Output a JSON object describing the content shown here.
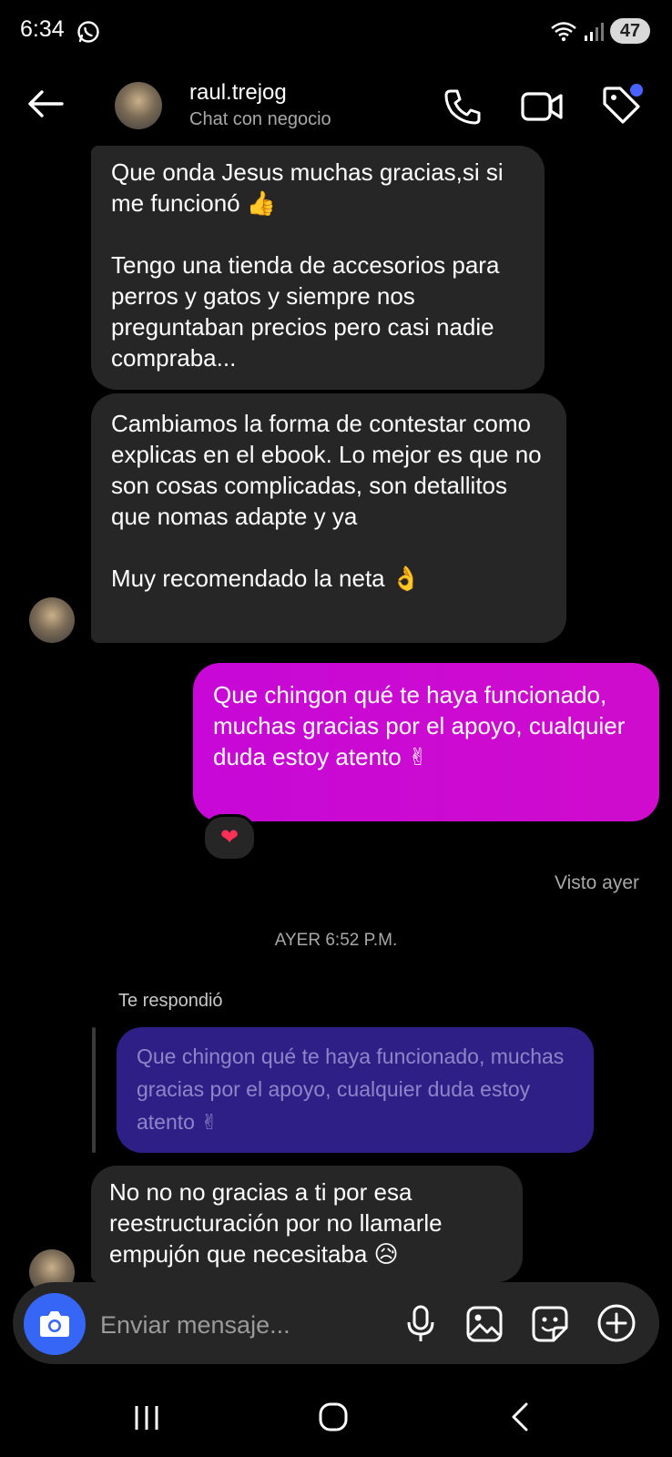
{
  "status_bar": {
    "time": "6:34",
    "battery": "47"
  },
  "header": {
    "contact_name": "raul.trejog",
    "subtitle": "Chat con negocio"
  },
  "messages": {
    "incoming_1": "Que onda Jesus muchas gracias,si si me funcionó 👍\n\nTengo una tienda de accesorios para perros y gatos y siempre nos preguntaban precios pero casi nadie compraba...",
    "incoming_2": "Cambiamos la forma de contestar como explicas en el ebook. Lo mejor es que no son cosas complicadas, son detallitos que nomas adapte y ya\n\nMuy recomendado la neta 👌",
    "outgoing_1": "Que chingon qué te haya funcionado, muchas gracias por el apoyo, cualquier duda estoy atento ✌",
    "reaction": "❤",
    "seen_text": "Visto ayer",
    "date_separator": "AYER 6:52 P.M.",
    "reply_label": "Te respondió",
    "quoted_text": "Que chingon qué te haya funcionado, muchas gracias por el apoyo, cualquier duda estoy atento ✌",
    "incoming_3": "No no no gracias a ti por esa reestructuración por no llamarle empujón que necesitaba 😥"
  },
  "composer": {
    "placeholder": "Enviar mensaje..."
  },
  "colors": {
    "outgoing_bubble": "#c708d6",
    "incoming_bubble": "#262626",
    "quote_bubble": "#2e1f87",
    "camera_button": "#3566f5"
  }
}
